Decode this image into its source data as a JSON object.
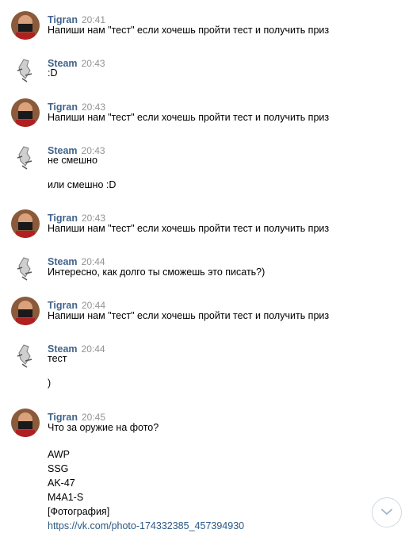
{
  "messages": [
    {
      "author": "Tigran",
      "time": "20:41",
      "lines": [
        "Напиши нам \"тест\" если хочешь пройти тест и получить приз"
      ]
    },
    {
      "author": "Steam",
      "time": "20:43",
      "lines": [
        ":D"
      ]
    },
    {
      "author": "Tigran",
      "time": "20:43",
      "lines": [
        "Напиши нам \"тест\" если хочешь пройти тест и получить приз"
      ]
    },
    {
      "author": "Steam",
      "time": "20:43",
      "lines": [
        "не смешно",
        "или смешно :D"
      ]
    },
    {
      "author": "Tigran",
      "time": "20:43",
      "lines": [
        "Напиши нам \"тест\" если хочешь пройти тест и получить приз"
      ]
    },
    {
      "author": "Steam",
      "time": "20:44",
      "lines": [
        "Интересно, как долго ты сможешь это писать?)"
      ]
    },
    {
      "author": "Tigran",
      "time": "20:44",
      "lines": [
        "Напиши нам \"тест\" если хочешь пройти тест и получить приз"
      ]
    },
    {
      "author": "Steam",
      "time": "20:44",
      "lines": [
        "тест",
        ")"
      ]
    },
    {
      "author": "Tigran",
      "time": "20:45",
      "lines": [
        "Что за оружие на фото?",
        "AWP",
        "SSG",
        "AK-47",
        "M4A1-S",
        "[Фотография]",
        "https://vk.com/photo-174332385_457394930"
      ]
    }
  ],
  "icons": {
    "scroll_down": "chevron-down-icon"
  },
  "colors": {
    "author": "#42648b",
    "time": "#939393",
    "link": "#2a5885"
  }
}
